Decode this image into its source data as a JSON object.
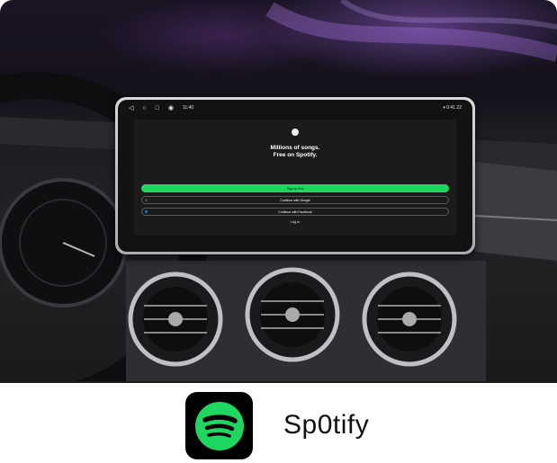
{
  "head_unit": {
    "status_time": "11:40",
    "status_right": "▾ 0:41 22",
    "icons": [
      "back-icon",
      "home-icon",
      "recents-icon",
      "record-icon"
    ]
  },
  "spotify_screen": {
    "tagline_line1": "Millions of songs.",
    "tagline_line2": "Free on Spotify.",
    "signup_label": "Sign up free",
    "google_label": "Continue with Google",
    "facebook_label": "Continue with Facebook",
    "login_label": "Log in",
    "accent_color": "#1ED760"
  },
  "footer": {
    "app_name": "Sp0tify",
    "icon": "spotify-logo-icon"
  }
}
